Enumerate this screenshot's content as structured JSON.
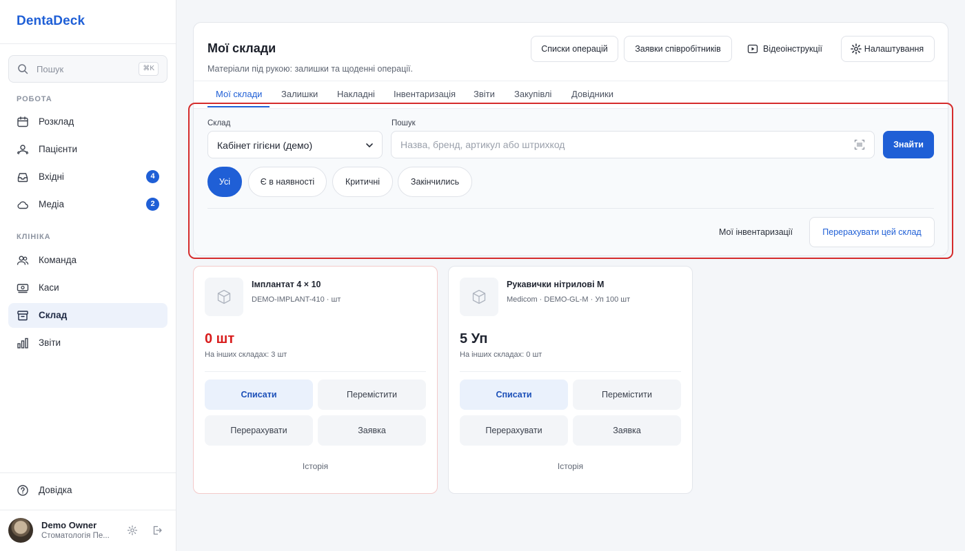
{
  "sidebar": {
    "brand": "DentaDeck",
    "search": {
      "placeholder": "Пошук",
      "shortcut": "⌘K"
    },
    "sections": [
      {
        "label": "РОБОТА",
        "items": [
          {
            "label": "Розклад",
            "icon": "calendar-icon"
          },
          {
            "label": "Пацієнти",
            "icon": "users-icon"
          },
          {
            "label": "Вхідні",
            "icon": "inbox-icon",
            "badge": "4"
          },
          {
            "label": "Медіа",
            "icon": "cloud-icon",
            "badge": "2"
          }
        ]
      },
      {
        "label": "КЛІНІКА",
        "items": [
          {
            "label": "Команда",
            "icon": "team-icon"
          },
          {
            "label": "Каси",
            "icon": "cash-icon"
          },
          {
            "label": "Склад",
            "icon": "archive-icon",
            "active": true
          },
          {
            "label": "Звіти",
            "icon": "bar-chart-icon"
          }
        ]
      }
    ],
    "help": "Довідка",
    "user": {
      "name": "Demo Owner",
      "org": "Стоматологія Пе..."
    }
  },
  "header": {
    "title": "Мої склади",
    "subtitle": "Матеріали під рукою: залишки та щоденні операції.",
    "buttons": {
      "operations": "Списки операцій",
      "requests": "Заявки співробітників",
      "videos": "Відеоінструкції",
      "settings": "Налаштування"
    }
  },
  "tabs": [
    "Мої склади",
    "Залишки",
    "Накладні",
    "Інвентаризація",
    "Звіти",
    "Закупівлі",
    "Довідники"
  ],
  "filters": {
    "warehouse_label": "Склад",
    "warehouse_value": "Кабінет гігієни (демо)",
    "search_label": "Пошук",
    "search_placeholder": "Назва, бренд, артикул або штрихкод",
    "find_button": "Знайти",
    "pills": [
      "Усі",
      "Є в наявності",
      "Критичні",
      "Закінчились"
    ],
    "my_inventories": "Мої інвентаризації",
    "recount_button": "Перерахувати цей склад"
  },
  "products": [
    {
      "name": "Імплантат 4 × 10",
      "meta": "DEMO-IMPLANT-410 · шт",
      "quantity": "0 шт",
      "other": "На інших складах: 3 шт"
    },
    {
      "name": "Рукавички нітрилові M",
      "meta": "Medicom · DEMO-GL-M · Уп 100 шт",
      "quantity": "5 Уп",
      "other": "На інших складах: 0 шт"
    }
  ],
  "product_actions": {
    "write_off": "Списати",
    "move": "Перемістити",
    "recount": "Перерахувати",
    "request": "Заявка",
    "history": "Історія"
  },
  "colors": {
    "accent": "#1f5fd6",
    "critical": "#d81b1b",
    "highlight": "#d52b2b"
  }
}
